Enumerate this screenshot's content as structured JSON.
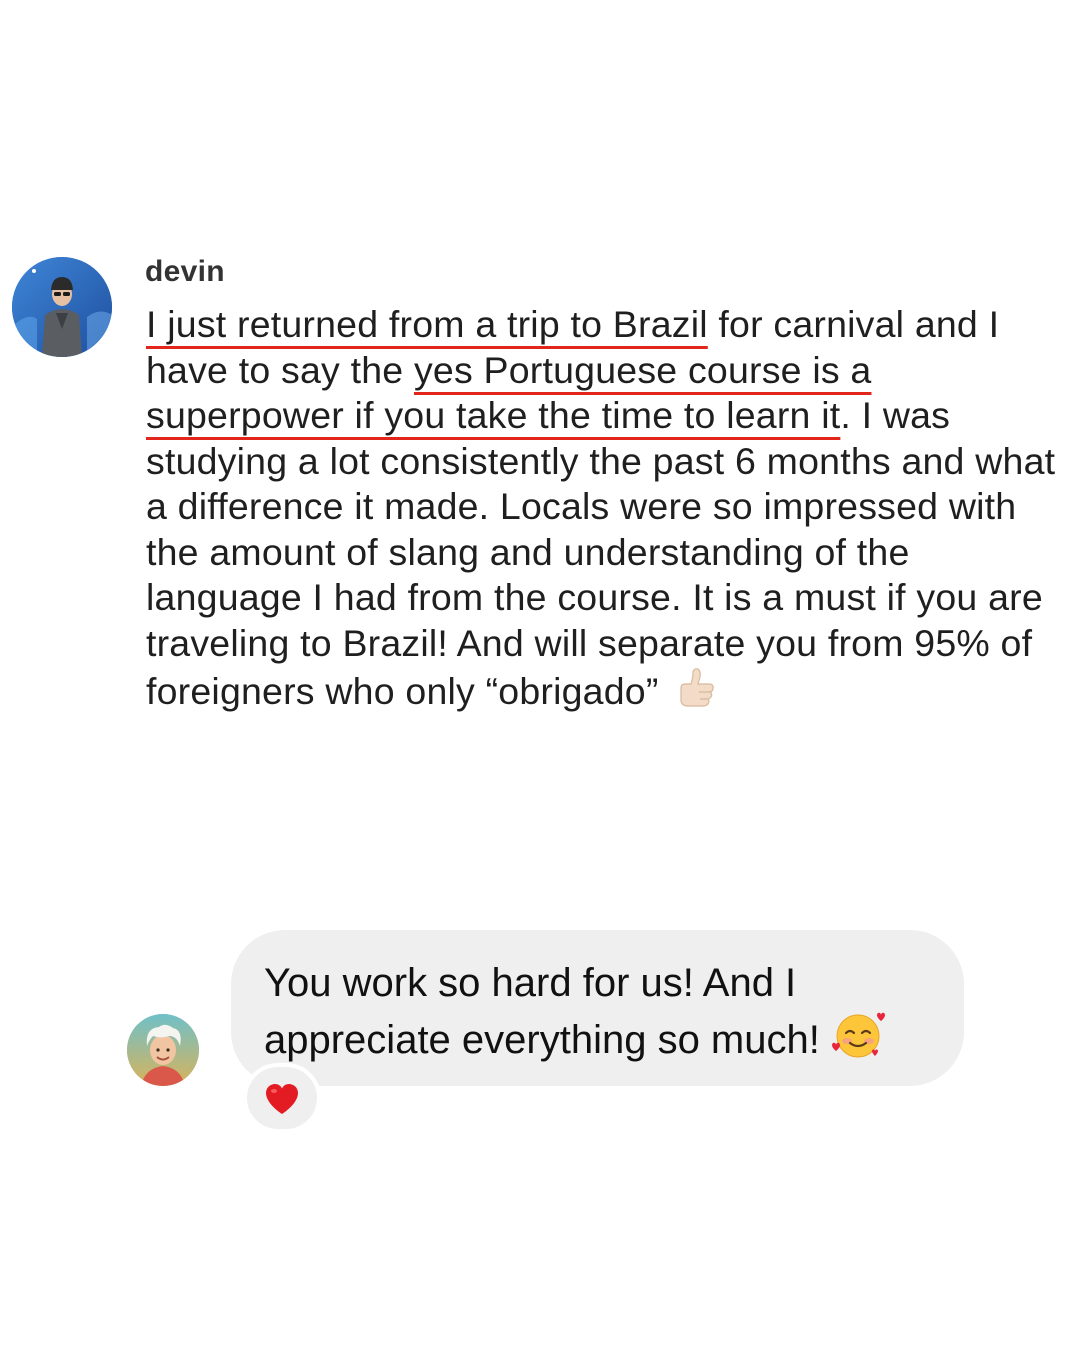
{
  "comment": {
    "username": "devin",
    "segments": {
      "s1": "I just returned from a trip to Brazil",
      "s2": " for carnival and I have to say the ",
      "s3": "yes Portuguese course is a superpower if you take the time to learn it",
      "s4": ". I was studying a lot consistently the past 6 months and what a difference it made. Locals were so impressed with the amount of slang and understanding of the language I had from the course. It is a must if you are traveling to Brazil! And will separate you from 95% of foreigners who only “obrigado”"
    },
    "trailing_emoji": "thumbs-up-emoji",
    "underline_color": "#e3261b",
    "avatar_icon": "user-photo-avatar"
  },
  "reply": {
    "text": "You work so hard for us!  And I appreciate everything so much!",
    "trailing_emoji": "smiling-face-with-hearts-emoji",
    "reaction_icon": "red-heart-icon",
    "avatar_icon": "cartoon-avatar",
    "bubble_color": "#efefef"
  }
}
